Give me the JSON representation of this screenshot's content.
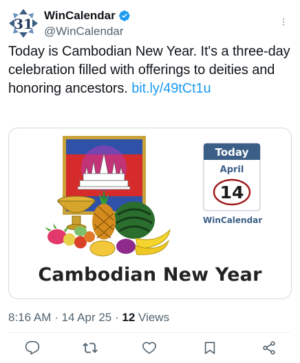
{
  "author": {
    "display_name": "WinCalendar",
    "handle": "@WinCalendar",
    "avatar_text": "31"
  },
  "tweet": {
    "text": "Today is Cambodian New Year. It's a three-day celebration filled with offerings to deities and honoring ancestors. ",
    "link": "bit.ly/49tCt1u"
  },
  "media": {
    "banner_text": "Cambodian New Year",
    "calendar": {
      "header": "Today",
      "month": "April",
      "day": "14",
      "brand": "WinCalendar"
    }
  },
  "meta": {
    "time": "8:16 AM",
    "date": "14 Apr 25",
    "views_count": "12",
    "views_label": "Views"
  },
  "actions": [
    "reply",
    "repost",
    "like",
    "bookmark",
    "share"
  ],
  "colors": {
    "accent": "#1d9bf0",
    "secondary_text": "#536471",
    "border": "#cfd9de",
    "flag_blue": "#2f52a8",
    "flag_red": "#d62b2b",
    "calendar_blue": "#3b5e86"
  }
}
